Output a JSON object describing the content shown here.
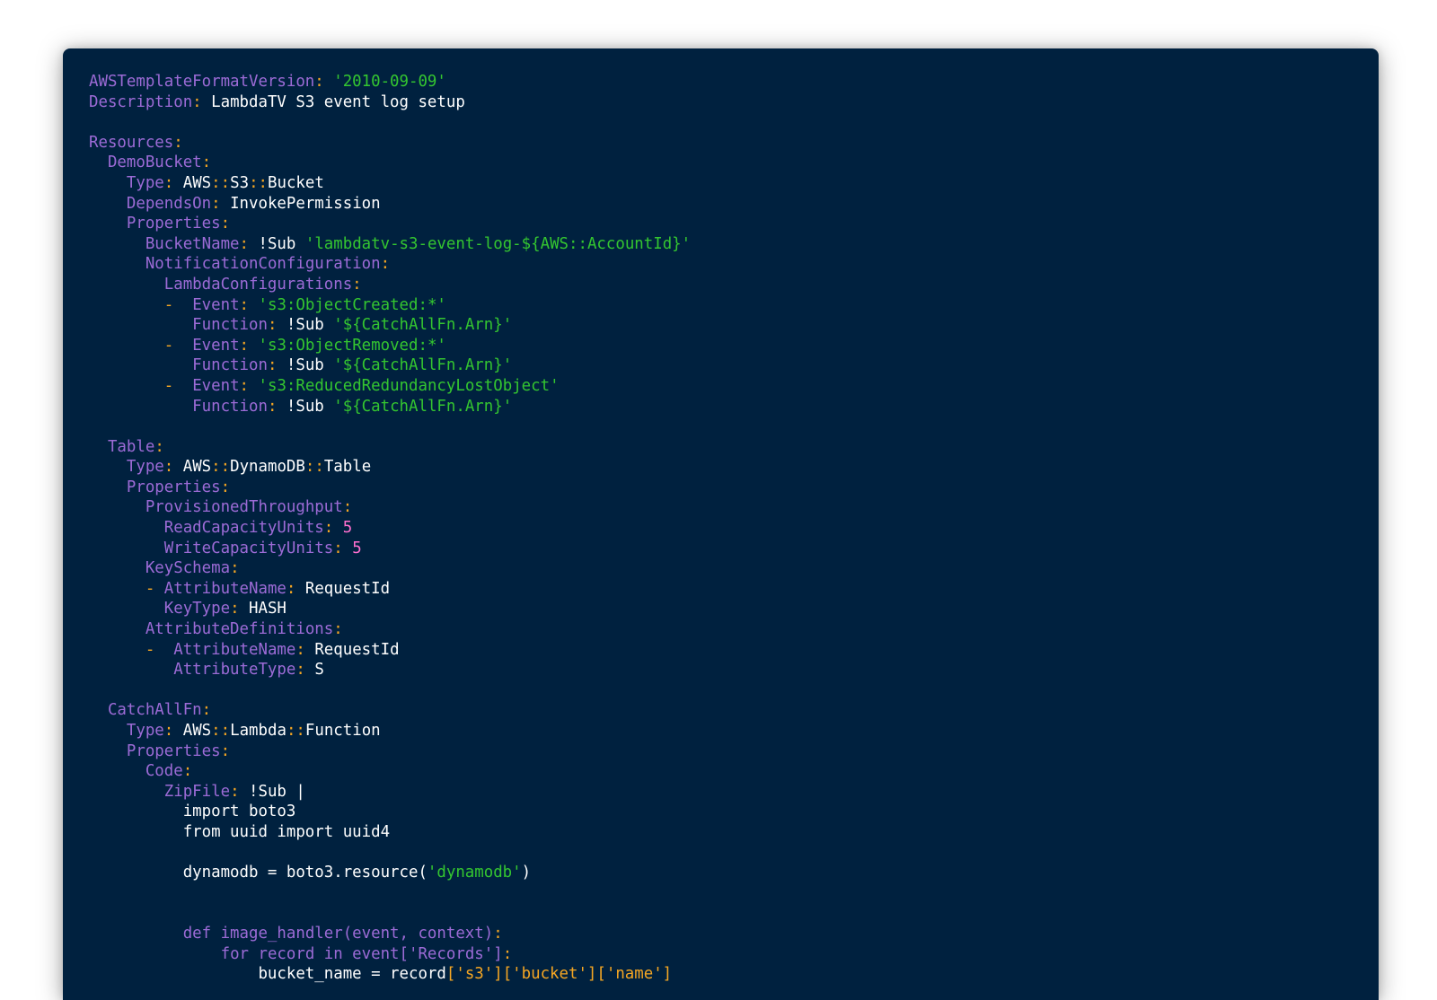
{
  "code_lines": [
    [
      [
        "k",
        "AWSTemplateFormatVersion"
      ],
      [
        "p",
        ": "
      ],
      [
        "s",
        "'2010-09-09'"
      ]
    ],
    [
      [
        "k",
        "Description"
      ],
      [
        "p",
        ": "
      ],
      [
        "v",
        "LambdaTV S3 event log setup"
      ]
    ],
    [],
    [
      [
        "k",
        "Resources"
      ],
      [
        "p",
        ":"
      ]
    ],
    [
      [
        "v",
        "  "
      ],
      [
        "k",
        "DemoBucket"
      ],
      [
        "p",
        ":"
      ]
    ],
    [
      [
        "v",
        "    "
      ],
      [
        "k",
        "Type"
      ],
      [
        "p",
        ": "
      ],
      [
        "v",
        "AWS"
      ],
      [
        "p",
        "::"
      ],
      [
        "v",
        "S3"
      ],
      [
        "p",
        "::"
      ],
      [
        "v",
        "Bucket"
      ]
    ],
    [
      [
        "v",
        "    "
      ],
      [
        "k",
        "DependsOn"
      ],
      [
        "p",
        ": "
      ],
      [
        "v",
        "InvokePermission"
      ]
    ],
    [
      [
        "v",
        "    "
      ],
      [
        "k",
        "Properties"
      ],
      [
        "p",
        ":"
      ]
    ],
    [
      [
        "v",
        "      "
      ],
      [
        "k",
        "BucketName"
      ],
      [
        "p",
        ": "
      ],
      [
        "v",
        "!Sub "
      ],
      [
        "s",
        "'lambdatv-s3-event-log-${AWS::AccountId}'"
      ]
    ],
    [
      [
        "v",
        "      "
      ],
      [
        "k",
        "NotificationConfiguration"
      ],
      [
        "p",
        ":"
      ]
    ],
    [
      [
        "v",
        "        "
      ],
      [
        "k",
        "LambdaConfigurations"
      ],
      [
        "p",
        ":"
      ]
    ],
    [
      [
        "v",
        "        "
      ],
      [
        "p",
        "-  "
      ],
      [
        "k",
        "Event"
      ],
      [
        "p",
        ": "
      ],
      [
        "s",
        "'s3:ObjectCreated:*'"
      ]
    ],
    [
      [
        "v",
        "           "
      ],
      [
        "k",
        "Function"
      ],
      [
        "p",
        ": "
      ],
      [
        "v",
        "!Sub "
      ],
      [
        "s",
        "'${CatchAllFn.Arn}'"
      ]
    ],
    [
      [
        "v",
        "        "
      ],
      [
        "p",
        "-  "
      ],
      [
        "k",
        "Event"
      ],
      [
        "p",
        ": "
      ],
      [
        "s",
        "'s3:ObjectRemoved:*'"
      ]
    ],
    [
      [
        "v",
        "           "
      ],
      [
        "k",
        "Function"
      ],
      [
        "p",
        ": "
      ],
      [
        "v",
        "!Sub "
      ],
      [
        "s",
        "'${CatchAllFn.Arn}'"
      ]
    ],
    [
      [
        "v",
        "        "
      ],
      [
        "p",
        "-  "
      ],
      [
        "k",
        "Event"
      ],
      [
        "p",
        ": "
      ],
      [
        "s",
        "'s3:ReducedRedundancyLostObject'"
      ]
    ],
    [
      [
        "v",
        "           "
      ],
      [
        "k",
        "Function"
      ],
      [
        "p",
        ": "
      ],
      [
        "v",
        "!Sub "
      ],
      [
        "s",
        "'${CatchAllFn.Arn}'"
      ]
    ],
    [],
    [
      [
        "v",
        "  "
      ],
      [
        "k",
        "Table"
      ],
      [
        "p",
        ":"
      ]
    ],
    [
      [
        "v",
        "    "
      ],
      [
        "k",
        "Type"
      ],
      [
        "p",
        ": "
      ],
      [
        "v",
        "AWS"
      ],
      [
        "p",
        "::"
      ],
      [
        "v",
        "DynamoDB"
      ],
      [
        "p",
        "::"
      ],
      [
        "v",
        "Table"
      ]
    ],
    [
      [
        "v",
        "    "
      ],
      [
        "k",
        "Properties"
      ],
      [
        "p",
        ":"
      ]
    ],
    [
      [
        "v",
        "      "
      ],
      [
        "k",
        "ProvisionedThroughput"
      ],
      [
        "p",
        ":"
      ]
    ],
    [
      [
        "v",
        "        "
      ],
      [
        "k",
        "ReadCapacityUnits"
      ],
      [
        "p",
        ": "
      ],
      [
        "n",
        "5"
      ]
    ],
    [
      [
        "v",
        "        "
      ],
      [
        "k",
        "WriteCapacityUnits"
      ],
      [
        "p",
        ": "
      ],
      [
        "n",
        "5"
      ]
    ],
    [
      [
        "v",
        "      "
      ],
      [
        "k",
        "KeySchema"
      ],
      [
        "p",
        ":"
      ]
    ],
    [
      [
        "v",
        "      "
      ],
      [
        "p",
        "- "
      ],
      [
        "k",
        "AttributeName"
      ],
      [
        "p",
        ": "
      ],
      [
        "v",
        "RequestId"
      ]
    ],
    [
      [
        "v",
        "        "
      ],
      [
        "k",
        "KeyType"
      ],
      [
        "p",
        ": "
      ],
      [
        "v",
        "HASH"
      ]
    ],
    [
      [
        "v",
        "      "
      ],
      [
        "k",
        "AttributeDefinitions"
      ],
      [
        "p",
        ":"
      ]
    ],
    [
      [
        "v",
        "      "
      ],
      [
        "p",
        "-  "
      ],
      [
        "k",
        "AttributeName"
      ],
      [
        "p",
        ": "
      ],
      [
        "v",
        "RequestId"
      ]
    ],
    [
      [
        "v",
        "         "
      ],
      [
        "k",
        "AttributeType"
      ],
      [
        "p",
        ": "
      ],
      [
        "v",
        "S"
      ]
    ],
    [],
    [
      [
        "v",
        "  "
      ],
      [
        "k",
        "CatchAllFn"
      ],
      [
        "p",
        ":"
      ]
    ],
    [
      [
        "v",
        "    "
      ],
      [
        "k",
        "Type"
      ],
      [
        "p",
        ": "
      ],
      [
        "v",
        "AWS"
      ],
      [
        "p",
        "::"
      ],
      [
        "v",
        "Lambda"
      ],
      [
        "p",
        "::"
      ],
      [
        "v",
        "Function"
      ]
    ],
    [
      [
        "v",
        "    "
      ],
      [
        "k",
        "Properties"
      ],
      [
        "p",
        ":"
      ]
    ],
    [
      [
        "v",
        "      "
      ],
      [
        "k",
        "Code"
      ],
      [
        "p",
        ":"
      ]
    ],
    [
      [
        "v",
        "        "
      ],
      [
        "k",
        "ZipFile"
      ],
      [
        "p",
        ": "
      ],
      [
        "v",
        "!Sub |"
      ]
    ],
    [
      [
        "v",
        "          import boto3"
      ]
    ],
    [
      [
        "v",
        "          from uuid import uuid4"
      ]
    ],
    [],
    [
      [
        "v",
        "          dynamodb = boto3.resource("
      ],
      [
        "s",
        "'dynamodb'"
      ],
      [
        "v",
        ")"
      ]
    ],
    [],
    [],
    [
      [
        "v",
        "          "
      ],
      [
        "k",
        "def image_handler(event, context)"
      ],
      [
        "p",
        ":"
      ]
    ],
    [
      [
        "v",
        "              "
      ],
      [
        "k",
        "for record in event['Records']"
      ],
      [
        "p",
        ":"
      ]
    ],
    [
      [
        "v",
        "                  bucket_name = record"
      ],
      [
        "p",
        "['s3']['bucket']['name']"
      ]
    ]
  ]
}
